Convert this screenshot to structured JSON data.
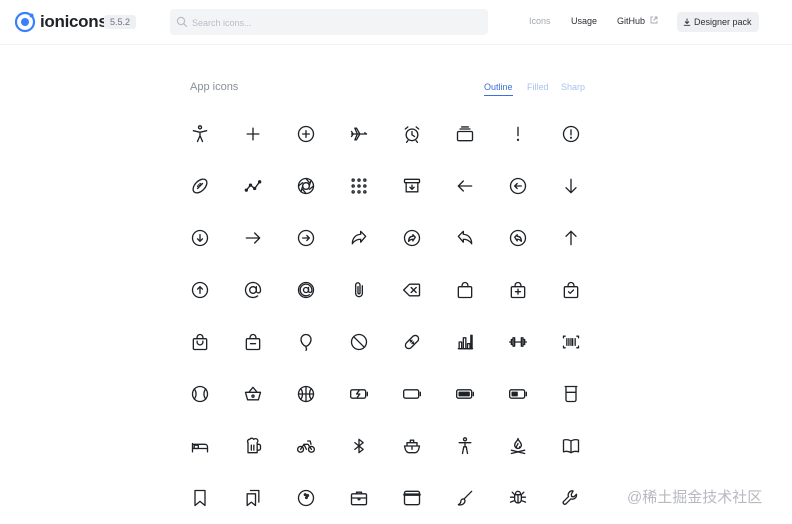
{
  "header": {
    "brand": "ionicons",
    "version": "5.5.2",
    "search_placeholder": "Search icons...",
    "nav": {
      "icons": "Icons",
      "usage": "Usage",
      "github": "GitHub"
    },
    "designer_pack": "Designer pack"
  },
  "section": {
    "title": "App icons",
    "tabs": [
      "Outline",
      "Filled",
      "Sharp"
    ],
    "active_tab": "Outline"
  },
  "icons": [
    "accessibility-outline",
    "add-outline",
    "add-circle-outline",
    "airplane-outline",
    "alarm-outline",
    "albums-outline",
    "alert-outline",
    "alert-circle-outline",
    "american-football-outline",
    "analytics-outline",
    "aperture-outline",
    "apps-outline",
    "archive-outline",
    "arrow-back-outline",
    "arrow-back-circle-outline",
    "arrow-down-outline",
    "arrow-down-circle-outline",
    "arrow-forward-outline",
    "arrow-forward-circle-outline",
    "arrow-redo-outline",
    "arrow-redo-circle-outline",
    "arrow-undo-outline",
    "arrow-undo-circle-outline",
    "arrow-up-outline",
    "arrow-up-circle-outline",
    "at-outline",
    "at-circle-outline",
    "attach-outline",
    "backspace-outline",
    "bag-outline",
    "bag-add-outline",
    "bag-check-outline",
    "bag-handle-outline",
    "bag-remove-outline",
    "balloon-outline",
    "ban-outline",
    "bandage-outline",
    "bar-chart-outline",
    "barbell-outline",
    "barcode-outline",
    "baseball-outline",
    "basket-outline",
    "basketball-outline",
    "battery-charging-outline",
    "battery-dead-outline",
    "battery-full-outline",
    "battery-half-outline",
    "beaker-outline",
    "bed-outline",
    "beer-outline",
    "bicycle-outline",
    "bluetooth-outline",
    "boat-outline",
    "body-outline",
    "bonfire-outline",
    "book-outline",
    "bookmark-outline",
    "bookmarks-outline",
    "bowling-ball-outline",
    "briefcase-outline",
    "browsers-outline",
    "brush-outline",
    "bug-outline",
    "build-outline"
  ],
  "watermark": "@稀土掘金技术社区"
}
